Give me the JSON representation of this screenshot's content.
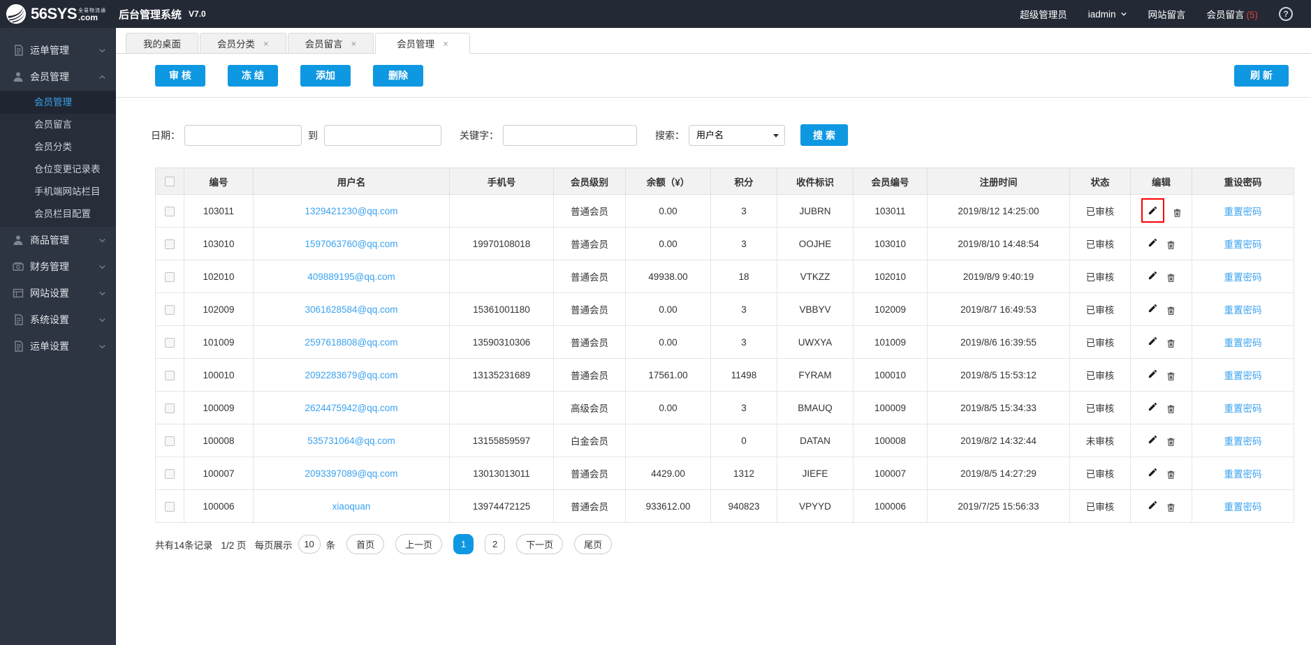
{
  "colors": {
    "accent": "#0f98e2",
    "link": "#3aa2ef",
    "topbar_bg": "#232935",
    "sidebar_bg": "#2d3442",
    "submenu_bg": "#272d39",
    "active_item_bg": "#202631",
    "badge_red": "#e04040",
    "highlight_box": "#ff0000"
  },
  "topbar": {
    "brand": "56SYS",
    "brand_tld": ".com",
    "brand_tagline": "全易物流通",
    "title": "后台管理系统",
    "version": "V7.0",
    "role": "超级管理员",
    "username": "iadmin",
    "site_messages": "网站留言",
    "member_messages": "会员留言",
    "member_messages_count": "(5)",
    "help": "?"
  },
  "sidebar": {
    "items": [
      {
        "label": "运单管理",
        "icon": "waybill-icon",
        "expanded": false
      },
      {
        "label": "会员管理",
        "icon": "member-icon",
        "expanded": true,
        "children": [
          {
            "label": "会员管理",
            "active": true
          },
          {
            "label": "会员留言",
            "active": false
          },
          {
            "label": "会员分类",
            "active": false
          },
          {
            "label": "仓位变更记录表",
            "active": false
          },
          {
            "label": "手机端网站栏目",
            "active": false
          },
          {
            "label": "会员栏目配置",
            "active": false
          }
        ]
      },
      {
        "label": "商品管理",
        "icon": "goods-icon",
        "expanded": false
      },
      {
        "label": "财务管理",
        "icon": "finance-icon",
        "expanded": false
      },
      {
        "label": "网站设置",
        "icon": "website-icon",
        "expanded": false
      },
      {
        "label": "系统设置",
        "icon": "system-icon",
        "expanded": false
      },
      {
        "label": "运单设置",
        "icon": "waybill-icon",
        "expanded": false
      }
    ]
  },
  "tabs": [
    {
      "label": "我的桌面",
      "closable": false,
      "active": false
    },
    {
      "label": "会员分类",
      "closable": true,
      "active": false
    },
    {
      "label": "会员留言",
      "closable": true,
      "active": false
    },
    {
      "label": "会员管理",
      "closable": true,
      "active": true
    }
  ],
  "toolbar": {
    "audit": "审 核",
    "freeze": "冻 结",
    "add": "添加",
    "delete": "删除",
    "refresh": "刷 新"
  },
  "filters": {
    "date_label": "日期：",
    "to_label": "到",
    "keyword_label": "关键字：",
    "search_label": "搜索：",
    "search_type_selected": "用户名",
    "search_button": "搜 索",
    "date_from_value": "",
    "date_to_value": "",
    "keyword_value": ""
  },
  "table": {
    "headers": [
      "编号",
      "用户名",
      "手机号",
      "会员级别",
      "余额（¥）",
      "积分",
      "收件标识",
      "会员编号",
      "注册时间",
      "状态",
      "编辑",
      "重设密码"
    ],
    "reset_link_label": "重置密码",
    "rows": [
      {
        "id": "103011",
        "username": "1329421230@qq.com",
        "phone": "",
        "level": "普通会员",
        "balance": "0.00",
        "points": "3",
        "code": "JUBRN",
        "member_id": "103011",
        "reg_time": "2019/8/12 14:25:00",
        "status": "已审核",
        "highlight_edit": true
      },
      {
        "id": "103010",
        "username": "1597063760@qq.com",
        "phone": "19970108018",
        "level": "普通会员",
        "balance": "0.00",
        "points": "3",
        "code": "OOJHE",
        "member_id": "103010",
        "reg_time": "2019/8/10 14:48:54",
        "status": "已审核",
        "highlight_edit": false
      },
      {
        "id": "102010",
        "username": "409889195@qq.com",
        "phone": "",
        "level": "普通会员",
        "balance": "49938.00",
        "points": "18",
        "code": "VTKZZ",
        "member_id": "102010",
        "reg_time": "2019/8/9 9:40:19",
        "status": "已审核",
        "highlight_edit": false
      },
      {
        "id": "102009",
        "username": "3061628584@qq.com",
        "phone": "15361001180",
        "level": "普通会员",
        "balance": "0.00",
        "points": "3",
        "code": "VBBYV",
        "member_id": "102009",
        "reg_time": "2019/8/7 16:49:53",
        "status": "已审核",
        "highlight_edit": false
      },
      {
        "id": "101009",
        "username": "2597618808@qq.com",
        "phone": "13590310306",
        "level": "普通会员",
        "balance": "0.00",
        "points": "3",
        "code": "UWXYA",
        "member_id": "101009",
        "reg_time": "2019/8/6 16:39:55",
        "status": "已审核",
        "highlight_edit": false
      },
      {
        "id": "100010",
        "username": "2092283679@qq.com",
        "phone": "13135231689",
        "level": "普通会员",
        "balance": "17561.00",
        "points": "11498",
        "code": "FYRAM",
        "member_id": "100010",
        "reg_time": "2019/8/5 15:53:12",
        "status": "已审核",
        "highlight_edit": false
      },
      {
        "id": "100009",
        "username": "2624475942@qq.com",
        "phone": "",
        "level": "高级会员",
        "balance": "0.00",
        "points": "3",
        "code": "BMAUQ",
        "member_id": "100009",
        "reg_time": "2019/8/5 15:34:33",
        "status": "已审核",
        "highlight_edit": false
      },
      {
        "id": "100008",
        "username": "535731064@qq.com",
        "phone": "13155859597",
        "level": "白金会员",
        "balance": "",
        "points": "0",
        "code": "DATAN",
        "member_id": "100008",
        "reg_time": "2019/8/2 14:32:44",
        "status": "未审核",
        "highlight_edit": false
      },
      {
        "id": "100007",
        "username": "2093397089@qq.com",
        "phone": "13013013011",
        "level": "普通会员",
        "balance": "4429.00",
        "points": "1312",
        "code": "JIEFE",
        "member_id": "100007",
        "reg_time": "2019/8/5 14:27:29",
        "status": "已审核",
        "highlight_edit": false
      },
      {
        "id": "100006",
        "username": "xiaoquan",
        "phone": "13974472125",
        "level": "普通会员",
        "balance": "933612.00",
        "points": "940823",
        "code": "VPYYD",
        "member_id": "100006",
        "reg_time": "2019/7/25 15:56:33",
        "status": "已审核",
        "highlight_edit": false
      }
    ]
  },
  "pagination": {
    "total_text": "共有14条记录",
    "page_info": "1/2 页",
    "per_page_prefix": "每页展示",
    "per_page_value": "10",
    "per_page_suffix": "条",
    "first": "首页",
    "prev": "上一页",
    "next": "下一页",
    "last": "尾页",
    "pages": [
      "1",
      "2"
    ],
    "active_page": "1"
  }
}
